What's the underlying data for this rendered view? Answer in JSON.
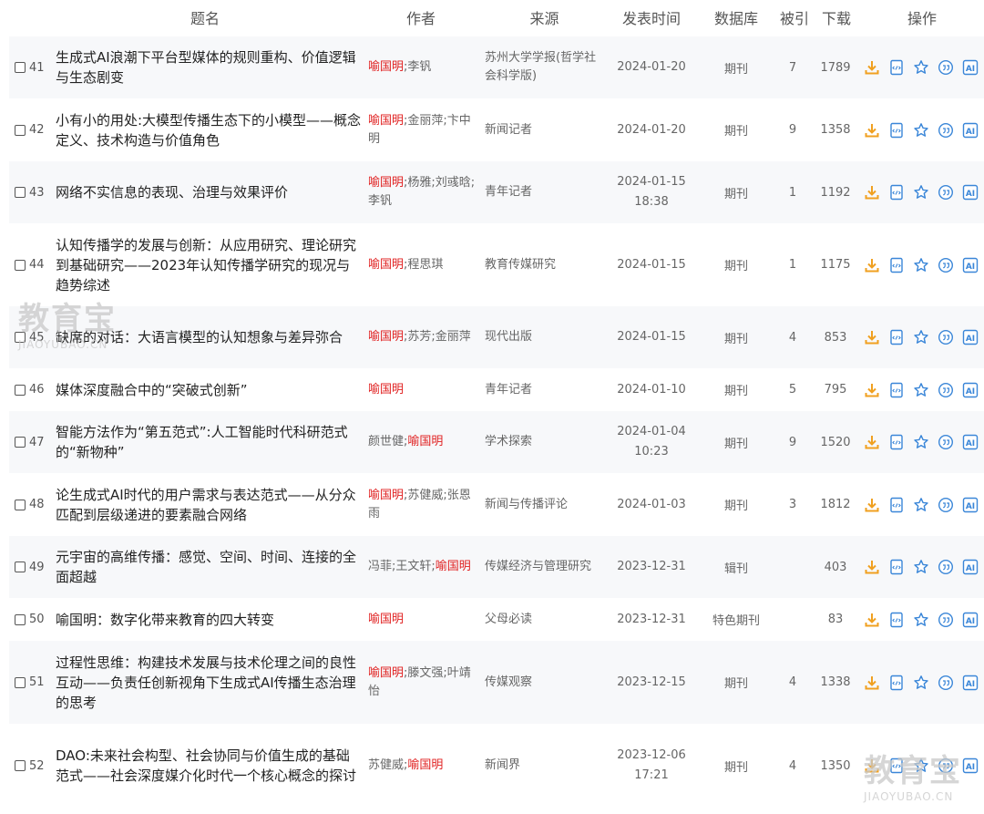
{
  "headers": {
    "title": "题名",
    "author": "作者",
    "source": "来源",
    "date": "发表时间",
    "database": "数据库",
    "cited": "被引",
    "downloads": "下载",
    "operations": "操作"
  },
  "watermark": {
    "name": "教育宝",
    "domain": "JIAOYUBAO.CN"
  },
  "op_labels": {
    "ai": "AI"
  },
  "rows": [
    {
      "num": "41",
      "title": "生成式AI浪潮下平台型媒体的规则重构、价值逻辑与生态剧变",
      "authors": [
        {
          "text": "喻国明",
          "hl": true
        },
        {
          "text": ";李钒",
          "hl": false
        }
      ],
      "source": "苏州大学学报(哲学社会科学版)",
      "date": "2024-01-20",
      "time": "",
      "db": "期刊",
      "cited": "7",
      "downloads": "1789"
    },
    {
      "num": "42",
      "title": "小有小的用处:大模型传播生态下的小模型——概念定义、技术构造与价值角色",
      "authors": [
        {
          "text": "喻国明",
          "hl": true
        },
        {
          "text": ";金丽萍;卞中明",
          "hl": false
        }
      ],
      "source": "新闻记者",
      "date": "2024-01-20",
      "time": "",
      "db": "期刊",
      "cited": "9",
      "downloads": "1358"
    },
    {
      "num": "43",
      "title": "网络不实信息的表现、治理与效果评价",
      "authors": [
        {
          "text": "喻国明",
          "hl": true
        },
        {
          "text": ";杨雅;刘彧晗;李钒",
          "hl": false
        }
      ],
      "source": "青年记者",
      "date": "2024-01-15",
      "time": "18:38",
      "db": "期刊",
      "cited": "1",
      "downloads": "1192"
    },
    {
      "num": "44",
      "title": "认知传播学的发展与创新：从应用研究、理论研究到基础研究——2023年认知传播学研究的现况与趋势综述",
      "authors": [
        {
          "text": "喻国明",
          "hl": true
        },
        {
          "text": ";程思琪",
          "hl": false
        }
      ],
      "source": "教育传媒研究",
      "date": "2024-01-15",
      "time": "",
      "db": "期刊",
      "cited": "1",
      "downloads": "1175"
    },
    {
      "num": "45",
      "title": "缺席的对话：大语言模型的认知想象与差异弥合",
      "authors": [
        {
          "text": "喻国明",
          "hl": true
        },
        {
          "text": ";苏芳;金丽萍",
          "hl": false
        }
      ],
      "source": "现代出版",
      "date": "2024-01-15",
      "time": "",
      "db": "期刊",
      "cited": "4",
      "downloads": "853"
    },
    {
      "num": "46",
      "title": "媒体深度融合中的“突破式创新”",
      "authors": [
        {
          "text": "喻国明",
          "hl": true
        }
      ],
      "source": "青年记者",
      "date": "2024-01-10",
      "time": "",
      "db": "期刊",
      "cited": "5",
      "downloads": "795"
    },
    {
      "num": "47",
      "title": "智能方法作为“第五范式”:人工智能时代科研范式的“新物种”",
      "authors": [
        {
          "text": "颜世健;",
          "hl": false
        },
        {
          "text": "喻国明",
          "hl": true
        }
      ],
      "source": "学术探索",
      "date": "2024-01-04",
      "time": "10:23",
      "db": "期刊",
      "cited": "9",
      "downloads": "1520"
    },
    {
      "num": "48",
      "title": "论生成式AI时代的用户需求与表达范式——从分众匹配到层级递进的要素融合网络",
      "authors": [
        {
          "text": "喻国明",
          "hl": true
        },
        {
          "text": ";苏健威;张恩雨",
          "hl": false
        }
      ],
      "source": "新闻与传播评论",
      "date": "2024-01-03",
      "time": "",
      "db": "期刊",
      "cited": "3",
      "downloads": "1812"
    },
    {
      "num": "49",
      "title": "元宇宙的高维传播：感觉、空间、时间、连接的全面超越",
      "authors": [
        {
          "text": "冯菲;王文轩;",
          "hl": false
        },
        {
          "text": "喻国明",
          "hl": true
        }
      ],
      "source": "传媒经济与管理研究",
      "date": "2023-12-31",
      "time": "",
      "db": "辑刊",
      "cited": "",
      "downloads": "403"
    },
    {
      "num": "50",
      "title": "喻国明：数字化带来教育的四大转变",
      "authors": [
        {
          "text": "喻国明",
          "hl": true
        }
      ],
      "source": "父母必读",
      "date": "2023-12-31",
      "time": "",
      "db": "特色期刊",
      "cited": "",
      "downloads": "83"
    },
    {
      "num": "51",
      "title": "过程性思维：构建技术发展与技术伦理之间的良性互动——负责任创新视角下生成式AI传播生态治理的思考",
      "authors": [
        {
          "text": "喻国明",
          "hl": true
        },
        {
          "text": ";滕文强;叶靖怡",
          "hl": false
        }
      ],
      "source": "传媒观察",
      "date": "2023-12-15",
      "time": "",
      "db": "期刊",
      "cited": "4",
      "downloads": "1338"
    },
    {
      "num": "52",
      "title": "DAO:未来社会构型、社会协同与价值生成的基础范式——社会深度媒介化时代一个核心概念的探讨",
      "authors": [
        {
          "text": "苏健威;",
          "hl": false
        },
        {
          "text": "喻国明",
          "hl": true
        }
      ],
      "source": "新闻界",
      "date": "2023-12-06",
      "time": "17:21",
      "db": "期刊",
      "cited": "4",
      "downloads": "1350"
    }
  ]
}
